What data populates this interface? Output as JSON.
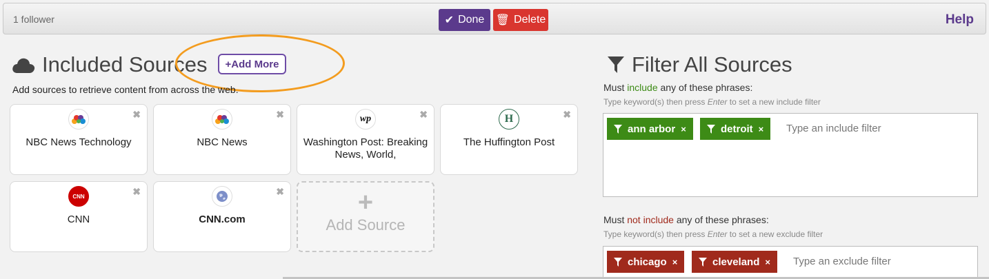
{
  "topbar": {
    "followers": "1 follower",
    "done": "Done",
    "delete": "Delete",
    "help": "Help"
  },
  "included": {
    "title": "Included Sources",
    "add_more": "+Add More",
    "hint": "Add sources to retrieve content from across the web.",
    "cards": [
      {
        "name": "NBC News Technology",
        "logo": "nbc-peacock-icon",
        "remove": "✖"
      },
      {
        "name": "NBC News",
        "logo": "nbc-peacock-icon",
        "remove": "✖"
      },
      {
        "name": "Washington Post: Breaking News, World,",
        "logo_text": "wp",
        "remove": "✖"
      },
      {
        "name": "The Huffington Post",
        "logo_text": "H",
        "remove": "✖"
      },
      {
        "name": "CNN",
        "logo_text": "CNN",
        "remove": "✖"
      },
      {
        "name": "CNN.com",
        "logo": "globe-icon",
        "remove": "✖"
      }
    ],
    "add_source": "Add Source",
    "add_source_plus": "+"
  },
  "filters": {
    "title": "Filter All Sources",
    "include": {
      "label_pre": "Must ",
      "label_key": "include",
      "label_post": " any of these phrases:",
      "hint_pre": "Type keyword(s) then press ",
      "hint_key": "Enter",
      "hint_post": " to set a new include filter",
      "tags": [
        "ann arbor",
        "detroit"
      ],
      "placeholder": "Type an include filter"
    },
    "exclude": {
      "label_pre": "Must ",
      "label_key": "not include",
      "label_post": " any of these phrases:",
      "hint_pre": "Type keyword(s) then press ",
      "hint_key": "Enter",
      "hint_post": " to set a new exclude filter",
      "tags": [
        "chicago",
        "cleveland"
      ],
      "placeholder": "Type an exclude filter"
    },
    "tag_remove": "×"
  },
  "colors": {
    "purple": "#5b3a8c",
    "red": "#d9362f",
    "include_green": "#3d8b16",
    "exclude_red": "#a02a1c",
    "highlight_orange": "#f39c1f"
  }
}
